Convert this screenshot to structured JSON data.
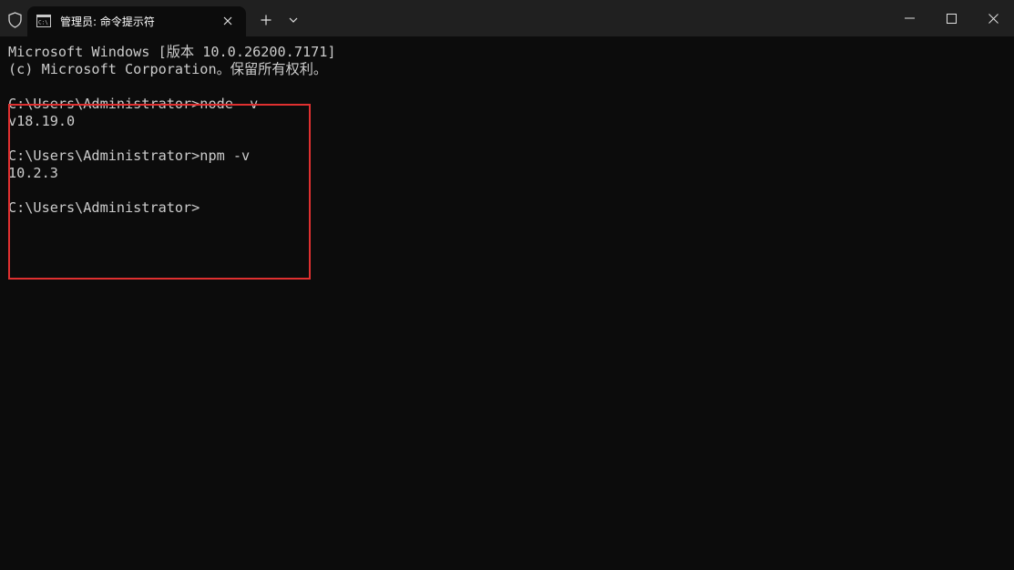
{
  "tab": {
    "title": "管理员: 命令提示符",
    "icon": "cmd-icon"
  },
  "titlebar": {
    "shield_icon": "shield-icon",
    "new_tab_icon": "plus-icon",
    "dropdown_icon": "chevron-down-icon",
    "minimize_icon": "minimize-icon",
    "maximize_icon": "maximize-icon",
    "close_icon": "close-icon"
  },
  "terminal": {
    "lines": [
      "Microsoft Windows [版本 10.0.26200.7171]",
      "(c) Microsoft Corporation。保留所有权利。",
      "",
      "C:\\Users\\Administrator>node -v",
      "v18.19.0",
      "",
      "C:\\Users\\Administrator>npm -v",
      "10.2.3",
      "",
      "C:\\Users\\Administrator>"
    ]
  },
  "colors": {
    "background": "#0c0c0c",
    "titlebar": "#202020",
    "text": "#cccccc",
    "annotation": "#e03030"
  }
}
